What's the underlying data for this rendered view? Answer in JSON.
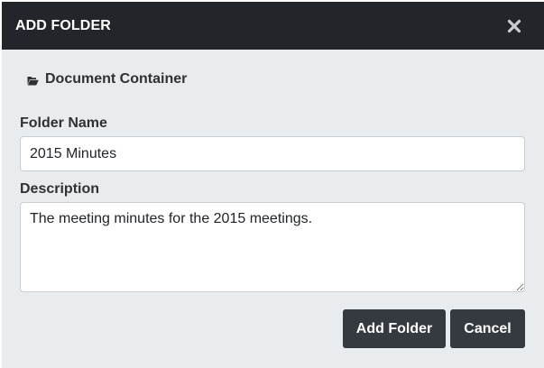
{
  "dialog": {
    "title": "ADD FOLDER",
    "close_icon": "close-icon"
  },
  "location": {
    "icon": "folder-open-icon",
    "label": "Document Container"
  },
  "form": {
    "folder_name_label": "Folder Name",
    "folder_name_value": "2015 Minutes",
    "description_label": "Description",
    "description_value": "The meeting minutes for the 2015 meetings."
  },
  "actions": {
    "add_label": "Add Folder",
    "cancel_label": "Cancel"
  },
  "colors": {
    "header_bg": "#22262b",
    "body_bg": "#e9ecef",
    "button_bg": "#343a40"
  }
}
